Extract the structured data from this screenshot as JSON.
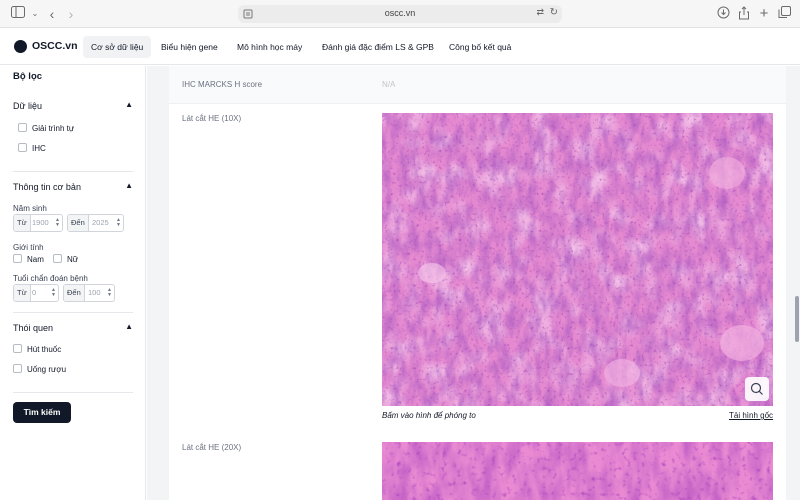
{
  "browser": {
    "url": "oscc.vn"
  },
  "nav": {
    "brand": "OSCC.vn",
    "items": [
      "Cơ sở dữ liệu",
      "Biểu hiện gene",
      "Mô hình học máy",
      "Đánh giá đặc điểm LS & GPB",
      "Công bố kết quả"
    ]
  },
  "sidebar": {
    "title": "Bộ lọc",
    "data_section": {
      "title": "Dữ liệu",
      "options": [
        "Giải trình tự",
        "IHC"
      ]
    },
    "basic_section": {
      "title": "Thông tin cơ bản",
      "birth_year_label": "Năm sinh",
      "from": "Từ",
      "to": "Đến",
      "birth_from": "1900",
      "birth_to": "2025",
      "gender_label": "Giới tính",
      "male": "Nam",
      "female": "Nữ",
      "age_label": "Tuổi chẩn đoán bệnh",
      "age_from": "0",
      "age_to": "100"
    },
    "habit_section": {
      "title": "Thói quen",
      "options": [
        "Hút thuốc",
        "Uống rượu"
      ]
    },
    "search_button": "Tìm kiếm"
  },
  "main": {
    "ihc_label": "IHC MARCKS H score",
    "ihc_value": "N/A",
    "he10_label": "Lát cắt HE (10X)",
    "he20_label": "Lát cắt HE (20X)",
    "image_caption": "Bấm vào hình để phóng to",
    "download_link": "Tải hình gốc"
  },
  "colors": {
    "accent": "#111827",
    "tissue_pink": "#e58ad0",
    "tissue_purple": "#8d4ab0"
  }
}
